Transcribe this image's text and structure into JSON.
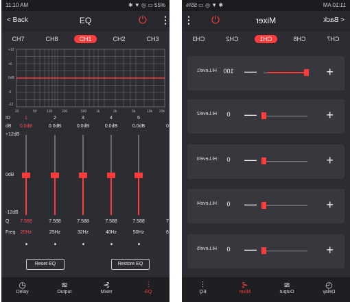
{
  "left": {
    "status": {
      "time": "11:10 AM",
      "icons": "✱ ▼ ◎ ▭ 55%"
    },
    "nav": {
      "back": "< Back",
      "title": "EQ"
    },
    "channels": [
      "CH7",
      "CH8",
      "CH1",
      "CH2",
      "CH3"
    ],
    "active_channel": "CH1",
    "graph": {
      "y_ticks": [
        "+12",
        "+6",
        "0dB",
        "-6",
        "-12"
      ],
      "x_ticks": [
        "20",
        "50",
        "100",
        "200",
        "500",
        "1k",
        "2k",
        "5k",
        "10k",
        "20k"
      ]
    },
    "labels": {
      "id": "ID",
      "db": "dB",
      "top": "+12dB",
      "mid": "0dB",
      "bottom": "-12dB",
      "q": "Q",
      "freq": "Freq"
    },
    "bands": [
      {
        "id": "1",
        "db": "0.0dB",
        "q": "7.588",
        "freq": "20Hz",
        "level": 0.0
      },
      {
        "id": "2",
        "db": "0.0dB",
        "q": "7.588",
        "freq": "25Hz",
        "level": 0.0
      },
      {
        "id": "3",
        "db": "0.0dB",
        "q": "7.588",
        "freq": "32Hz",
        "level": 0.0
      },
      {
        "id": "4",
        "db": "0.0dB",
        "q": "7.588",
        "freq": "40Hz",
        "level": 0.0
      },
      {
        "id": "5",
        "db": "0.0dB",
        "q": "7.588",
        "freq": "50Hz",
        "level": 0.0
      }
    ],
    "edge": {
      "db": "0",
      "q": "7",
      "freq": "6"
    },
    "buttons": {
      "reset": "Reset EQ",
      "restore": "Restore EQ"
    },
    "bottom_nav": [
      "Delay",
      "Output",
      "Mixer",
      "EQ"
    ],
    "active_tab": "EQ"
  },
  "right": {
    "status": {
      "time": "11:10 AM",
      "icons": "✱ ▼ ◎ ▭ 55%"
    },
    "nav": {
      "back": "< Back",
      "title": "Mixer"
    },
    "channels": [
      "CH7",
      "CH8",
      "CH1",
      "CH2",
      "CH3"
    ],
    "active_channel": "CH1",
    "mixers": [
      {
        "label": "Hi.Level1",
        "value": "100",
        "level": 1.0
      },
      {
        "label": "Hi.Level2",
        "value": "0",
        "level": 0.0
      },
      {
        "label": "Hi.Level3",
        "value": "0",
        "level": 0.0
      },
      {
        "label": "Hi.Level4",
        "value": "0",
        "level": 0.0
      },
      {
        "label": "Hi.Level5",
        "value": "0",
        "level": 0.0
      }
    ],
    "bottom_nav": [
      "Delay",
      "Output",
      "Mixer",
      "EQ"
    ],
    "active_tab": "Mixer"
  },
  "colors": {
    "accent": "#ff3b3b",
    "background": "#2b2d33",
    "panel": "#36383e"
  }
}
